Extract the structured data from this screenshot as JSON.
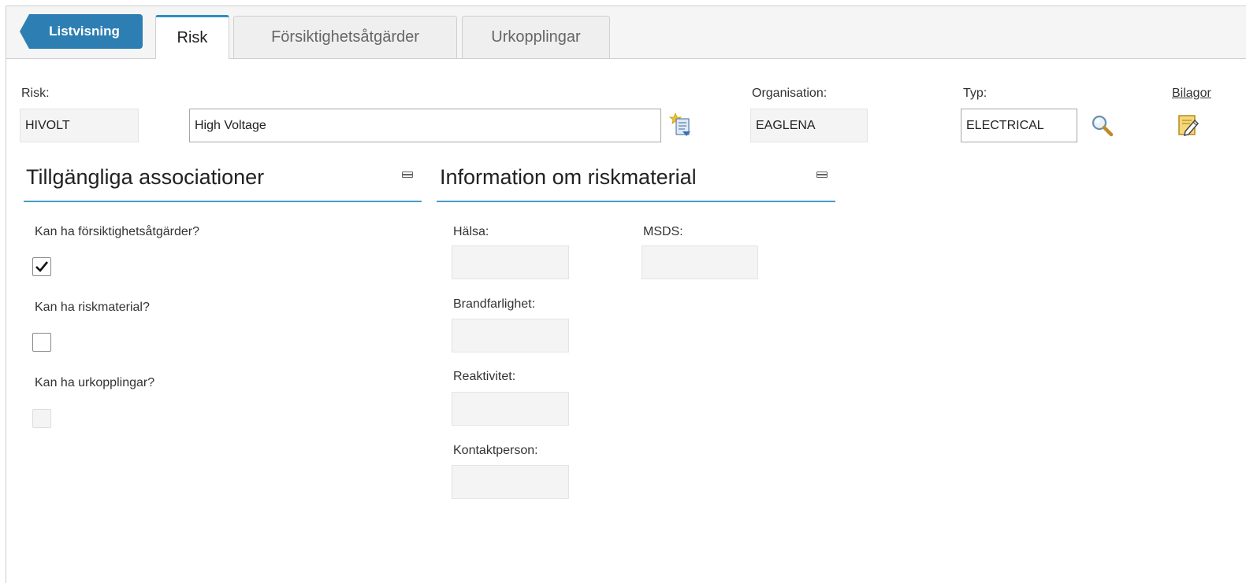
{
  "nav": {
    "back_label": "Listvisning",
    "tabs": [
      {
        "label": "Risk",
        "active": true
      },
      {
        "label": "Försiktighetsåtgärder",
        "active": false
      },
      {
        "label": "Urkopplingar",
        "active": false
      }
    ]
  },
  "header": {
    "risk_label": "Risk:",
    "risk_code": "HIVOLT",
    "risk_description": "High Voltage",
    "organisation_label": "Organisation:",
    "organisation_value": "EAGLENA",
    "type_label": "Typ:",
    "type_value": "ELECTRICAL",
    "attachments_label": "Bilagor"
  },
  "associations": {
    "title": "Tillgängliga associationer",
    "items": [
      {
        "label": "Kan ha försiktighetsåtgärder?",
        "checked": true,
        "enabled": true
      },
      {
        "label": "Kan ha riskmaterial?",
        "checked": false,
        "enabled": true
      },
      {
        "label": "Kan ha urkopplingar?",
        "checked": false,
        "enabled": false
      }
    ]
  },
  "hazmat": {
    "title": "Information om riskmaterial",
    "health_label": "Hälsa:",
    "health_value": "",
    "msds_label": "MSDS:",
    "msds_value": "",
    "flammability_label": "Brandfarlighet:",
    "flammability_value": "",
    "reactivity_label": "Reaktivitet:",
    "reactivity_value": "",
    "contact_label": "Kontaktperson:",
    "contact_value": ""
  },
  "colors": {
    "accent": "#2d7fb3",
    "section_line": "#4a9bc7"
  },
  "icons": {
    "description_icon": "notes-star-icon",
    "lookup_icon": "magnifier-icon",
    "attachments_icon": "edit-document-icon",
    "collapse_icon": "minimize-icon"
  }
}
